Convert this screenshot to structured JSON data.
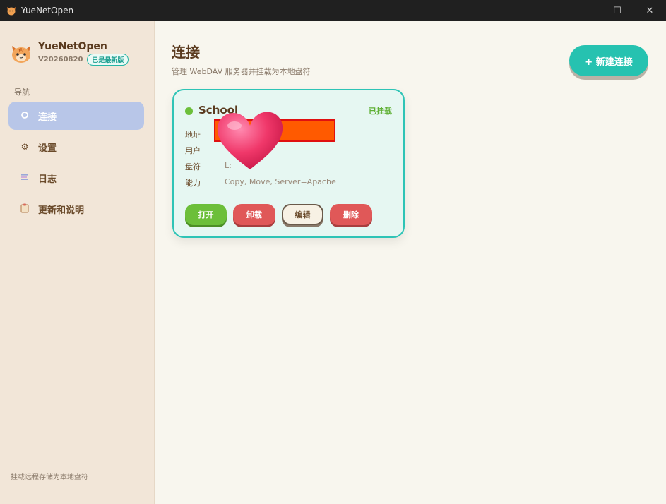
{
  "window": {
    "title": "YueNetOpen",
    "controls": {
      "minimize": "—",
      "maximize": "☐",
      "close": "✕"
    }
  },
  "sidebar": {
    "app_name": "YueNetOpen",
    "version": "V20260820",
    "badge": "已是最新版",
    "nav_heading": "导航",
    "items": [
      {
        "label": "连接",
        "icon": "link-icon",
        "active": true
      },
      {
        "label": "设置",
        "icon": "gear-icon",
        "active": false
      },
      {
        "label": "日志",
        "icon": "log-icon",
        "active": false
      },
      {
        "label": "更新和说明",
        "icon": "clipboard-icon",
        "active": false
      }
    ],
    "footer": "挂载远程存储为本地盘符"
  },
  "main": {
    "title": "连接",
    "subtitle": "管理 WebDAV 服务器并挂载为本地盘符",
    "new_button": "+ 新建连接"
  },
  "card": {
    "name": "School",
    "status": "已挂载",
    "fields": [
      {
        "label": "地址",
        "value": ""
      },
      {
        "label": "用户",
        "value": ""
      },
      {
        "label": "盘符",
        "value": "L:"
      },
      {
        "label": "能力",
        "value": "Copy, Move, Server=Apache"
      }
    ],
    "buttons": {
      "open": "打开",
      "unmount": "卸载",
      "edit": "编辑",
      "delete": "删除"
    }
  },
  "colors": {
    "accent": "#26c2b0",
    "mounted": "#6cbf3a",
    "danger": "#e05858",
    "sidebar_bg": "#f2e6d8",
    "active_nav": "#b8c6e8"
  }
}
